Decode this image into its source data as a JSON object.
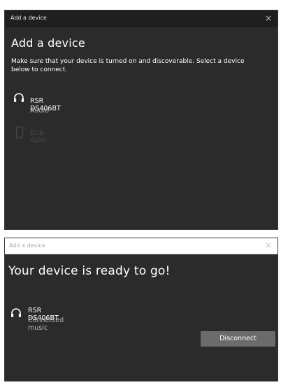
{
  "add_device_dialog": {
    "title_bar": "Add a device",
    "close_glyph": "×",
    "heading": "Add a device",
    "description": "Make sure that your device is turned on and discoverable. Select a device below to connect.",
    "devices": [
      {
        "name": "RSR DS406BT",
        "type": "Audio",
        "icon": "headphones-icon"
      },
      {
        "name": "DUB-AL00",
        "type": "",
        "icon": "phone-icon"
      }
    ]
  },
  "ready_dialog": {
    "title_bar": "Add a device",
    "close_glyph": "×",
    "heading": "Your device is ready to go!",
    "device": {
      "name": "RSR DS406BT",
      "status": "Connected music",
      "icon": "headphones-icon"
    },
    "disconnect_label": "Disconnect"
  }
}
